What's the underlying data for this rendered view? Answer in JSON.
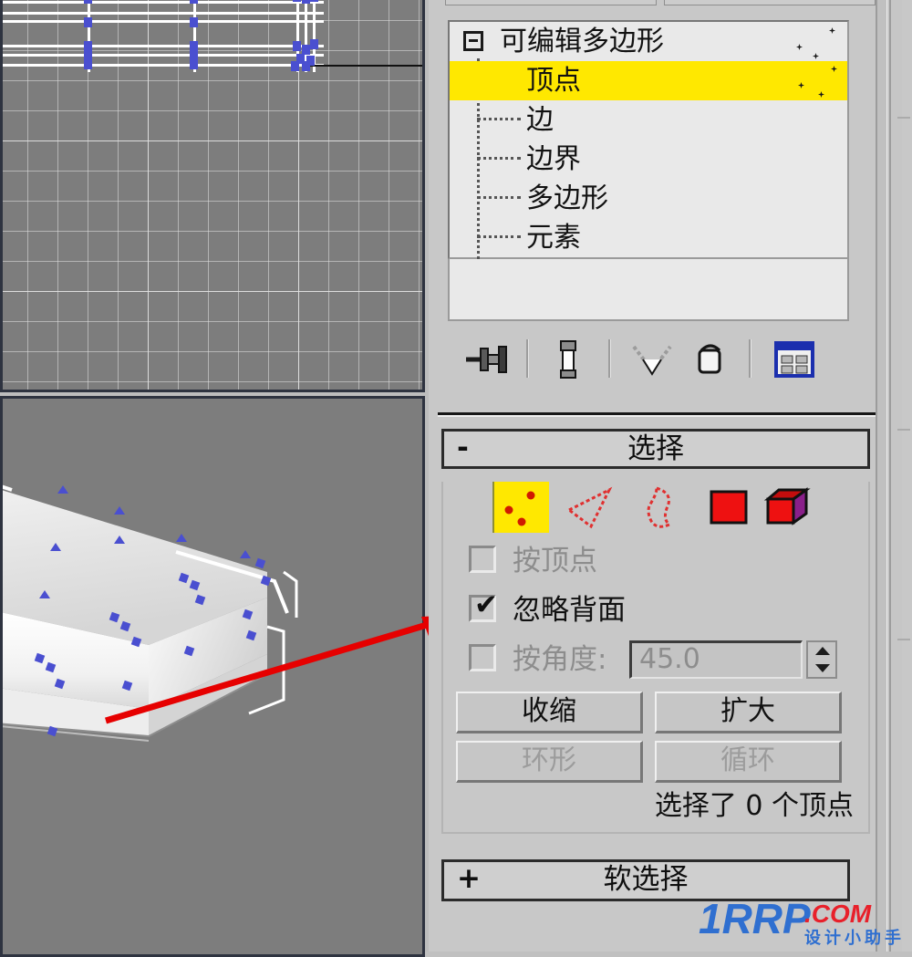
{
  "app": {
    "name": "3ds Max command panel",
    "colors": {
      "panel_bg": "#c8c8c8",
      "list_bg": "#e9e9e9",
      "highlight_yellow": "#ffe800",
      "viewport_bg": "#7d7d7d",
      "vertex_blue": "#4a4fd0",
      "annotation_red": "#e60000",
      "subobject_red": "#ee1111",
      "element_purple": "#8a1f8a"
    }
  },
  "viewports": {
    "top": {
      "name": "top-viewport",
      "label": ""
    },
    "perspective": {
      "name": "perspective-viewport",
      "label": ""
    }
  },
  "annotation": {
    "arrow_color": "#e60000",
    "name": "red-arrow"
  },
  "modifier_stack": {
    "root": {
      "label": "可编辑多边形",
      "collapse_state": "expanded",
      "collapse_glyph": "-"
    },
    "children": [
      {
        "label": "顶点",
        "selected": true
      },
      {
        "label": "边",
        "selected": false
      },
      {
        "label": "边界",
        "selected": false
      },
      {
        "label": "多边形",
        "selected": false
      },
      {
        "label": "元素",
        "selected": false
      }
    ]
  },
  "stack_toolbar": {
    "icons": [
      {
        "name": "pin-stack-icon",
        "title": "固定堆栈"
      },
      {
        "name": "show-end-result-icon",
        "title": "显示最终结果"
      },
      {
        "name": "make-unique-icon",
        "title": "使唯一"
      },
      {
        "name": "remove-modifier-icon",
        "title": "从堆栈中移除修改器"
      },
      {
        "name": "configure-modifier-sets-icon",
        "title": "配置修改器集"
      }
    ]
  },
  "selection_rollout": {
    "title": "选择",
    "toggle_glyph": "-",
    "subobject_buttons": [
      {
        "name": "vertex",
        "label": "顶点",
        "active": true
      },
      {
        "name": "edge",
        "label": "边",
        "active": false
      },
      {
        "name": "border",
        "label": "边界",
        "active": false
      },
      {
        "name": "polygon",
        "label": "多边形",
        "active": false
      },
      {
        "name": "element",
        "label": "元素",
        "active": false
      }
    ],
    "checkboxes": [
      {
        "label": "按顶点",
        "checked": false,
        "disabled": true,
        "tick": ""
      },
      {
        "label": "忽略背面",
        "checked": true,
        "disabled": false,
        "tick": "✔"
      },
      {
        "label": "按角度:",
        "checked": false,
        "disabled": true,
        "tick": ""
      }
    ],
    "angle_value": "45.0",
    "buttons": [
      {
        "label": "收缩",
        "disabled": false
      },
      {
        "label": "扩大",
        "disabled": false
      },
      {
        "label": "环形",
        "disabled": true
      },
      {
        "label": "循环",
        "disabled": true
      }
    ],
    "status": "选择了 0 个顶点"
  },
  "soft_selection_rollout": {
    "title": "软选择",
    "toggle_glyph": "+"
  },
  "watermark": {
    "primary": "1RRP",
    "suffix": ".COM",
    "tagline": "设计小助手",
    "primary_color": "#2f6fd0",
    "suffix_color": "#e8202a"
  }
}
